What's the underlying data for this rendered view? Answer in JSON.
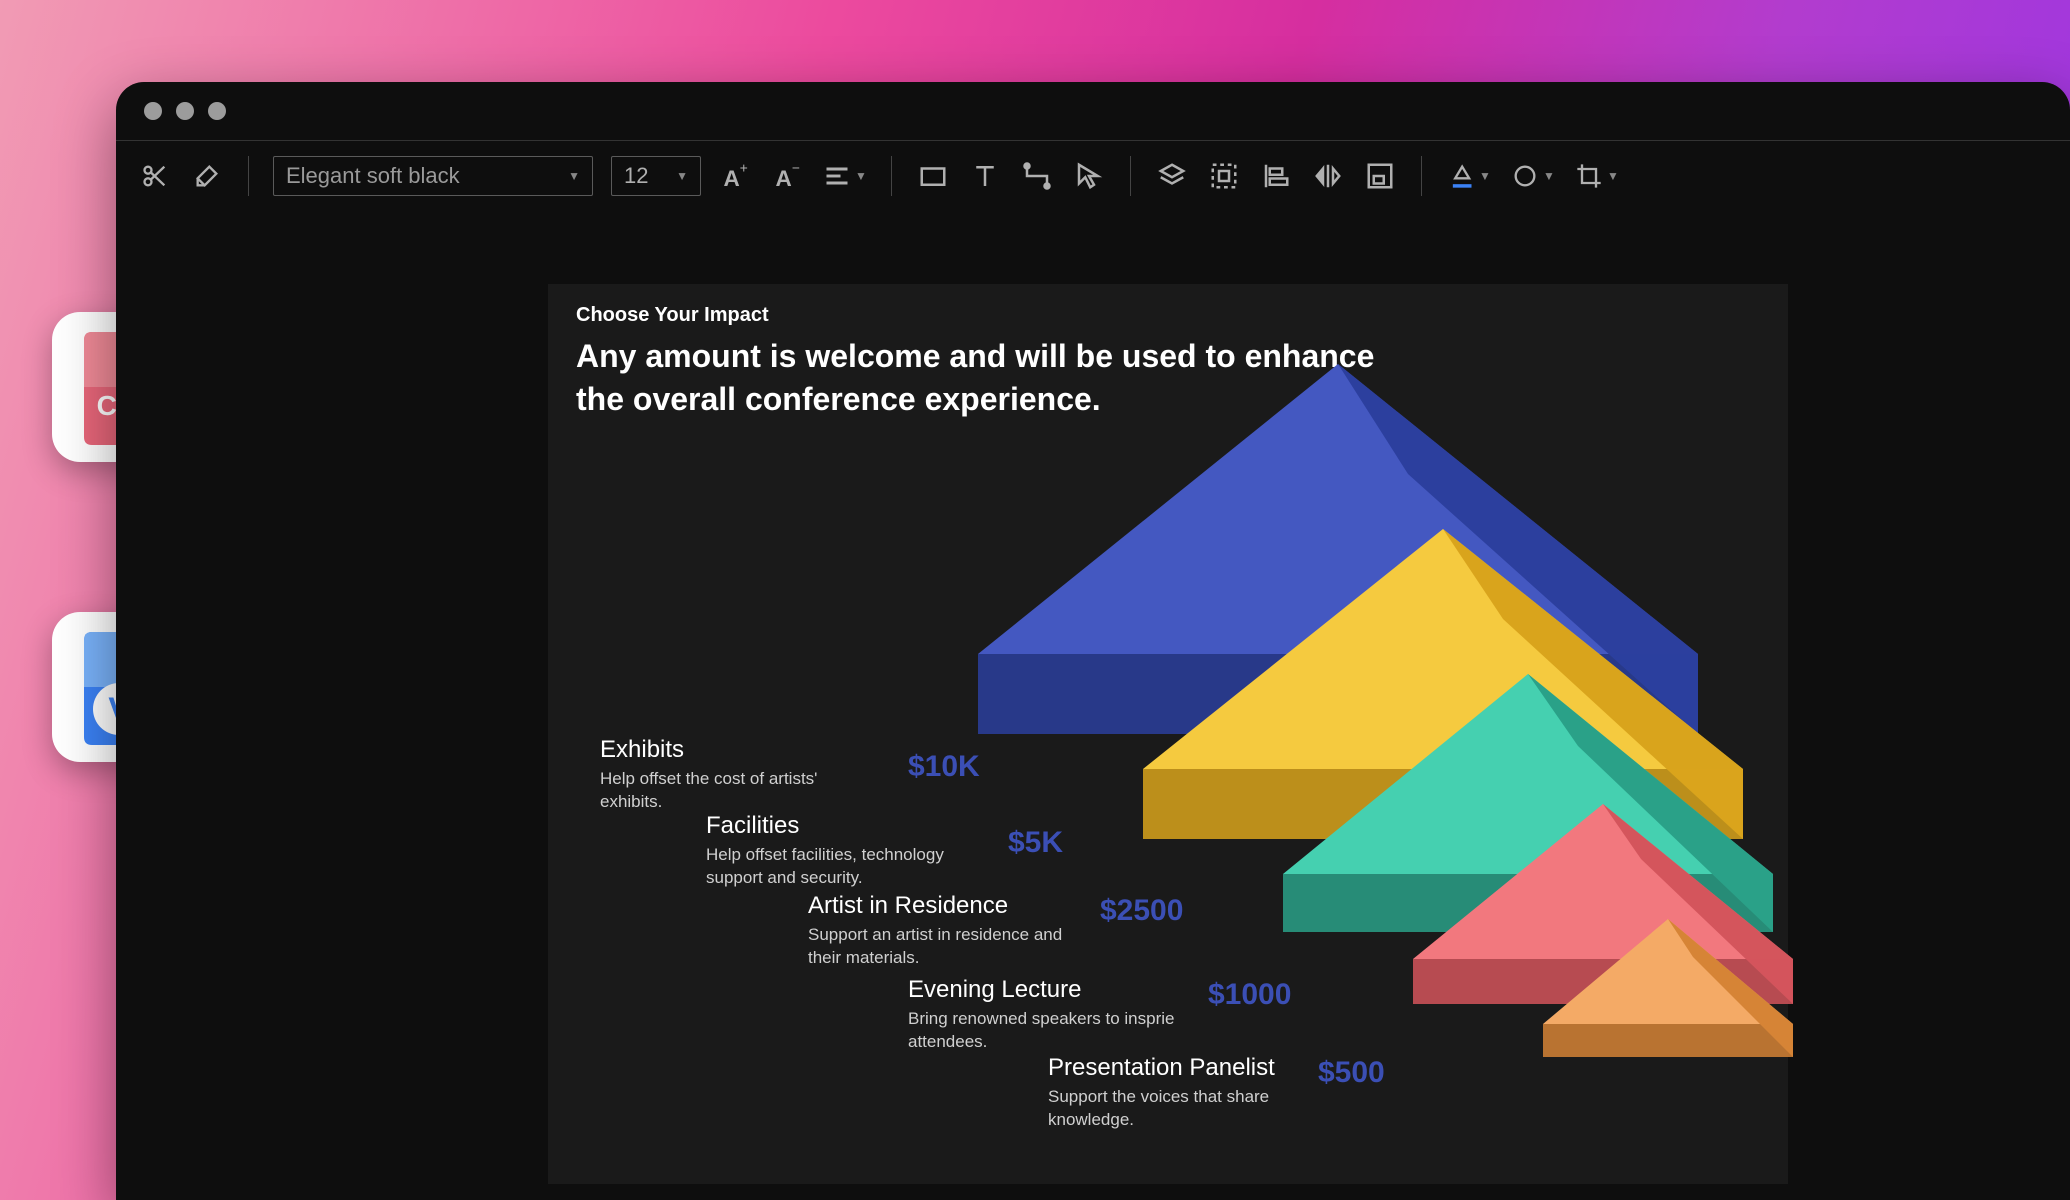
{
  "toolbar": {
    "font_name": "Elegant soft black",
    "font_size": "12"
  },
  "slide": {
    "subtitle": "Choose Your Impact",
    "title": "Any amount is welcome and will be used to enhance the overall conference experience."
  },
  "tiers": [
    {
      "label": "Exhibits",
      "desc": "Help offset the cost of artists' exhibits.",
      "amount": "$10K",
      "color": "#3b4fb5"
    },
    {
      "label": "Facilities",
      "desc": "Help offset facilities, technology support and security.",
      "amount": "$5K",
      "color": "#f2c233"
    },
    {
      "label": "Artist in Residence",
      "desc": "Support an artist in residence and their materials.",
      "amount": "$2500",
      "color": "#3bc9a9"
    },
    {
      "label": "Evening Lecture",
      "desc": "Bring renowned speakers to insprie attendees.",
      "amount": "$1000",
      "color": "#f06d76"
    },
    {
      "label": "Presentation Panelist",
      "desc": "Support the voices that share knowledge.",
      "amount": "$500",
      "color": "#f2a35e"
    }
  ],
  "external_icons": {
    "cad": "CAD",
    "visio": "V"
  }
}
